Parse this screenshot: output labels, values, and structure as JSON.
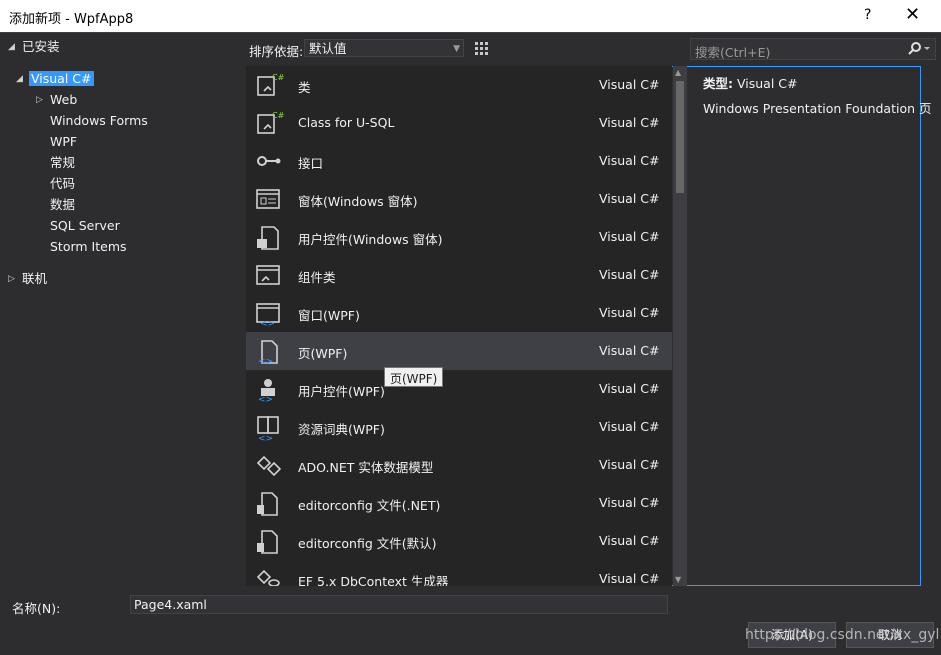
{
  "window": {
    "title": "添加新项 - WpfApp8",
    "help": "?",
    "close": "✕"
  },
  "tree": {
    "installed": "已安装",
    "visual_csharp": "Visual C#",
    "children": [
      "Web",
      "Windows Forms",
      "WPF",
      "常规",
      "代码",
      "数据",
      "SQL Server",
      "Storm Items"
    ],
    "online": "联机"
  },
  "toolbar": {
    "sort_label": "排序依据:",
    "sort_value": "默认值",
    "search_placeholder": "搜索(Ctrl+E)"
  },
  "items": [
    {
      "name": "类",
      "lang": "Visual C#",
      "icon": "class-icon"
    },
    {
      "name": "Class for U-SQL",
      "lang": "Visual C#",
      "icon": "class-icon"
    },
    {
      "name": "接口",
      "lang": "Visual C#",
      "icon": "interface-icon"
    },
    {
      "name": "窗体(Windows 窗体)",
      "lang": "Visual C#",
      "icon": "form-icon"
    },
    {
      "name": "用户控件(Windows 窗体)",
      "lang": "Visual C#",
      "icon": "usercontrol-icon"
    },
    {
      "name": "组件类",
      "lang": "Visual C#",
      "icon": "component-icon"
    },
    {
      "name": "窗口(WPF)",
      "lang": "Visual C#",
      "icon": "window-icon"
    },
    {
      "name": "页(WPF)",
      "lang": "Visual C#",
      "icon": "page-icon"
    },
    {
      "name": "用户控件(WPF)",
      "lang": "Visual C#",
      "icon": "usercontrol-wpf-icon"
    },
    {
      "name": "资源词典(WPF)",
      "lang": "Visual C#",
      "icon": "resource-dictionary-icon"
    },
    {
      "name": "ADO.NET 实体数据模型",
      "lang": "Visual C#",
      "icon": "entity-model-icon"
    },
    {
      "name": "editorconfig 文件(.NET)",
      "lang": "Visual C#",
      "icon": "editorconfig-icon"
    },
    {
      "name": "editorconfig 文件(默认)",
      "lang": "Visual C#",
      "icon": "editorconfig-icon"
    },
    {
      "name": "EF 5.x DbContext 生成器",
      "lang": "Visual C#",
      "icon": "dbcontext-icon"
    }
  ],
  "tooltip": "页(WPF)",
  "details": {
    "type_label": "类型:",
    "type_value": "Visual C#",
    "description": "Windows Presentation Foundation 页"
  },
  "bottom": {
    "name_label": "名称(N):",
    "name_value": "Page4.xaml",
    "add_button": "添加(A)",
    "cancel_button": "取消"
  },
  "watermark": "https://blog.csdn.net/xx_gyl",
  "colors": {
    "selection": "#3399ff",
    "background": "#2d2d30",
    "list_background": "#252526"
  }
}
